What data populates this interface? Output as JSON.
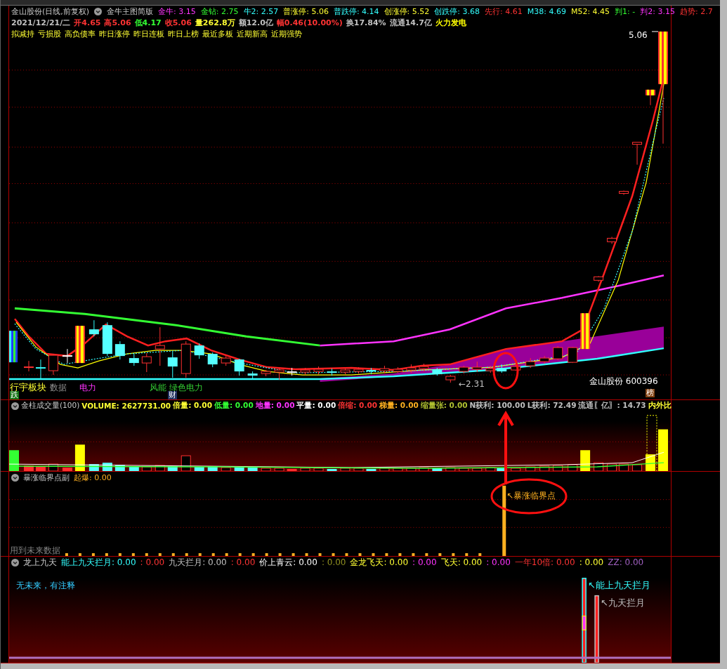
{
  "main_panel": {
    "title": "金山股份(日线,前复权)",
    "indicator": "金牛主图简版",
    "values": [
      {
        "text": "金牛: 3.15",
        "color": "#ff33ff"
      },
      {
        "text": "金钻: 2.75",
        "color": "#33ff33"
      },
      {
        "text": "牛2: 2.57",
        "color": "#33ffff"
      },
      {
        "text": "普涨停: 5.06",
        "color": "#ffff33"
      },
      {
        "text": "普跌停: 4.14",
        "color": "#33ffff"
      },
      {
        "text": "创涨停: 5.52",
        "color": "#ffff33"
      },
      {
        "text": "创跌停: 3.68",
        "color": "#33ffff"
      },
      {
        "text": "先行: 4.61",
        "color": "#ff3333"
      },
      {
        "text": "M38: 4.69",
        "color": "#33ffff"
      },
      {
        "text": "M52: 4.45",
        "color": "#ffff33"
      },
      {
        "text": "判1: -",
        "color": "#33ff33"
      },
      {
        "text": "判2: 3.15",
        "color": "#ff33ff"
      },
      {
        "text": "趋势: 2.7",
        "color": "#ff3333"
      }
    ],
    "quote": [
      {
        "text": "2021/12/21/二",
        "color": "#c0c0c0"
      },
      {
        "text": "开4.65",
        "color": "#ff3333"
      },
      {
        "text": "高5.06",
        "color": "#ff3333"
      },
      {
        "text": "低4.17",
        "color": "#33ff33"
      },
      {
        "text": "收5.06",
        "color": "#ff3333"
      },
      {
        "text": "量262.8万",
        "color": "#ffff33"
      },
      {
        "text": "额12.0亿",
        "color": "#c0c0c0"
      },
      {
        "text": "幅0.46(10.00%)",
        "color": "#ff3333"
      },
      {
        "text": "换17.84%",
        "color": "#c0c0c0"
      },
      {
        "text": "流通14.7亿",
        "color": "#c0c0c0"
      },
      {
        "text": "火力发电",
        "color": "#ffff00"
      }
    ],
    "tags": [
      "拟减持",
      "亏损股",
      "高负债率",
      "昨日涨停",
      "昨日连板",
      "昨日上榜",
      "最近多板",
      "近期新高",
      "近期强势"
    ],
    "high_label": "5.06",
    "low_label": "←2.31",
    "stock_label": "金山股份 600396",
    "badge": "榜",
    "sector_labels": [
      {
        "text": "行宇板块",
        "color": "#ffff33"
      },
      {
        "text": "数据",
        "color": "#909090"
      },
      {
        "text": "电力",
        "color": "#ff33ff"
      },
      {
        "text": "风能 绿色电力",
        "color": "#33cc33"
      }
    ],
    "fall_badge": "跌",
    "finance_badge": "财"
  },
  "volume_panel": {
    "title": "金柱成交量(100)",
    "values": [
      {
        "text": "VOLUME: 2627731.00",
        "color": "#ffff33"
      },
      {
        "text": "倍量: 0.00",
        "color": "#ffff33"
      },
      {
        "text": "低量: 0.00",
        "color": "#33ff33"
      },
      {
        "text": "地量: 0.00",
        "color": "#ff33ff"
      },
      {
        "text": "平量: 0.00",
        "color": "#ffffff"
      },
      {
        "text": "倍缩: 0.00",
        "color": "#ff3333"
      },
      {
        "text": "梯量: 0.00",
        "color": "#ffb020"
      },
      {
        "text": "缩量张: 0.00",
        "color": "#b0c030"
      },
      {
        "text": "N获利: 100.00",
        "color": "#c0c0c0"
      },
      {
        "text": "L获利: 72.49",
        "color": "#c0c0c0"
      },
      {
        "text": "流通〖亿〗: 14.73",
        "color": "#c0c0c0"
      },
      {
        "text": "内外比",
        "color": "#ffff33"
      }
    ]
  },
  "breakout_panel": {
    "title": "暴涨临界点副",
    "values": [
      {
        "text": "起爆: 0.00",
        "color": "#ffb020"
      }
    ],
    "marker_label": "↖暴涨临界点",
    "note": "用到未来数据"
  },
  "dragon_panel": {
    "title": "龙上九天",
    "values": [
      {
        "text": "能上九天拦月: 0.00",
        "color": "#33ffff"
      },
      {
        "text": ": 0.00",
        "color": "#ff3333"
      },
      {
        "text": "九天拦月: 0.00",
        "color": "#c0c0c0"
      },
      {
        "text": ": 0.00",
        "color": "#ff3333"
      },
      {
        "text": "价上青云: 0.00",
        "color": "#ffffff"
      },
      {
        "text": ": 0.00",
        "color": "#909020"
      },
      {
        "text": "金龙飞天: 0.00",
        "color": "#ffff33"
      },
      {
        "text": ": 0.00",
        "color": "#ff33ff"
      },
      {
        "text": "飞天: 0.00",
        "color": "#ffff33"
      },
      {
        "text": ": 0.00",
        "color": "#ff33ff"
      },
      {
        "text": "一年10倍: 0.00",
        "color": "#ff3333"
      },
      {
        "text": ": 0.00",
        "color": "#ffff33"
      },
      {
        "text": "ZZ: 0.00",
        "color": "#a060c0"
      }
    ],
    "note": "无未来，有注释",
    "bar_labels": [
      {
        "text": "↖能上九天拦月",
        "color": "#33ffff"
      },
      {
        "text": "↖九天拦月",
        "color": "#c0c0c0"
      }
    ]
  }
}
